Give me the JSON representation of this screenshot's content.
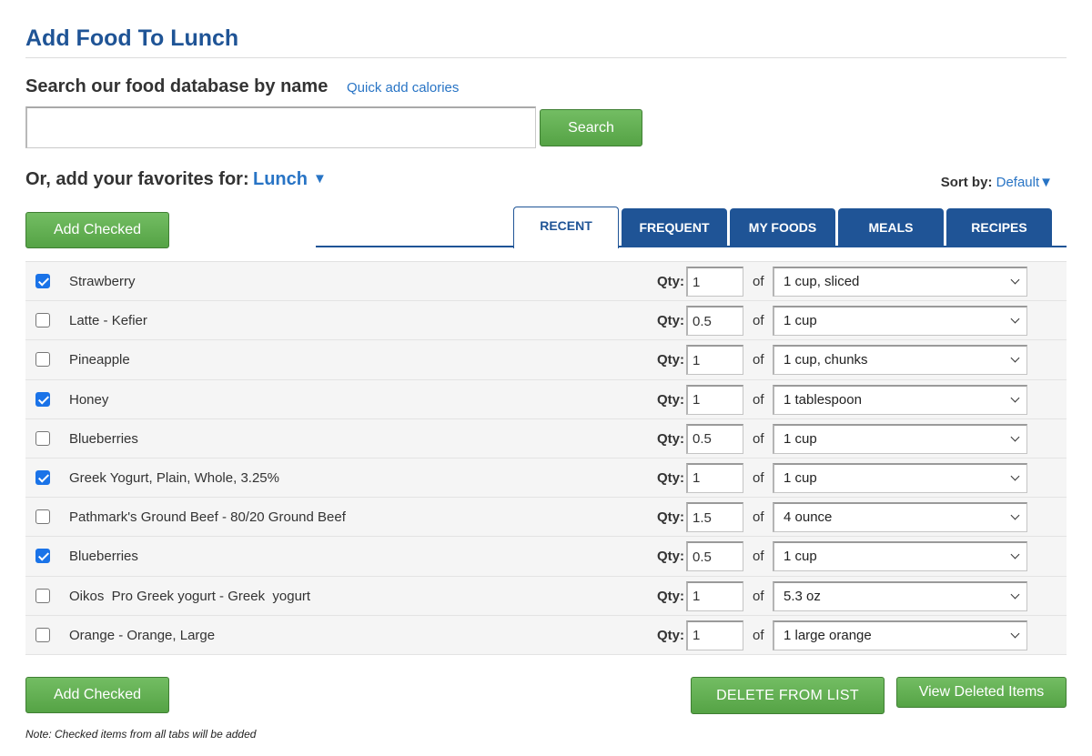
{
  "header": {
    "title": "Add Food To Lunch"
  },
  "search": {
    "heading": "Search our food database by name",
    "quick_add_label": "Quick add calories",
    "input_value": "",
    "button_label": "Search"
  },
  "favorites": {
    "label": "Or, add your favorites for:",
    "meal": "Lunch",
    "meal_arrow": "▼"
  },
  "sort": {
    "label": "Sort by:",
    "value": "Default",
    "arrow": "▼"
  },
  "buttons": {
    "add_checked": "Add Checked",
    "delete_from_list": "DELETE FROM LIST",
    "view_deleted": "View Deleted Items"
  },
  "tabs": [
    {
      "label": "RECENT",
      "active": true
    },
    {
      "label": "FREQUENT",
      "active": false
    },
    {
      "label": "MY FOODS",
      "active": false
    },
    {
      "label": "MEALS",
      "active": false
    },
    {
      "label": "RECIPES",
      "active": false
    }
  ],
  "row_labels": {
    "qty": "Qty:",
    "of": "of"
  },
  "foods": [
    {
      "name": "Strawberry",
      "checked": true,
      "qty": "1",
      "unit": "1 cup, sliced"
    },
    {
      "name": "Latte - Kefier",
      "checked": false,
      "qty": "0.5",
      "unit": "1 cup"
    },
    {
      "name": "Pineapple",
      "checked": false,
      "qty": "1",
      "unit": "1 cup, chunks"
    },
    {
      "name": "Honey",
      "checked": true,
      "qty": "1",
      "unit": "1 tablespoon"
    },
    {
      "name": "Blueberries",
      "checked": false,
      "qty": "0.5",
      "unit": "1 cup"
    },
    {
      "name": "Greek Yogurt, Plain, Whole, 3.25%",
      "checked": true,
      "qty": "1",
      "unit": "1 cup"
    },
    {
      "name": "Pathmark's Ground Beef - 80/20 Ground Beef",
      "checked": false,
      "qty": "1.5",
      "unit": "4 ounce"
    },
    {
      "name": "Blueberries",
      "checked": true,
      "qty": "0.5",
      "unit": "1 cup"
    },
    {
      "name": "Oikos  Pro Greek yogurt - Greek  yogurt",
      "checked": false,
      "qty": "1",
      "unit": "5.3 oz"
    },
    {
      "name": "Orange - Orange, Large",
      "checked": false,
      "qty": "1",
      "unit": "1 large orange"
    }
  ],
  "note": "Note: Checked items from all tabs will be added",
  "colors": {
    "accent_blue": "#1f5496",
    "link_blue": "#2874c5",
    "button_green": "#5cab4b"
  }
}
